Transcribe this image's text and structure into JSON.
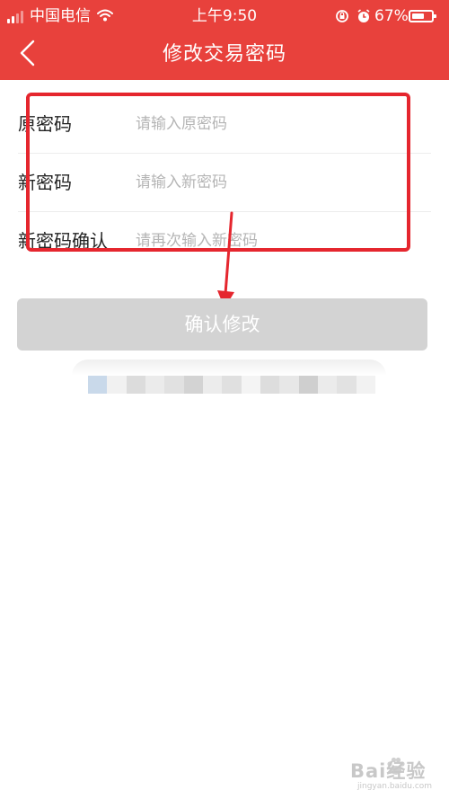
{
  "status_bar": {
    "carrier": "中国电信",
    "time": "上午9:50",
    "battery_percent": "67%",
    "battery_level": 0.67
  },
  "nav": {
    "title": "修改交易密码",
    "back_icon": "chevron-left-icon"
  },
  "form": {
    "rows": [
      {
        "label": "原密码",
        "placeholder": "请输入原密码"
      },
      {
        "label": "新密码",
        "placeholder": "请输入新密码"
      },
      {
        "label": "新密码确认",
        "placeholder": "请再次输入新密码"
      }
    ]
  },
  "confirm_button": {
    "label": "确认修改"
  },
  "watermark": {
    "brand": "Bai经验",
    "url": "jingyan.baidu.com"
  },
  "colors": {
    "header": "#e8413c",
    "annotation": "#e5262e",
    "disabled_button": "#d3d3d3"
  }
}
